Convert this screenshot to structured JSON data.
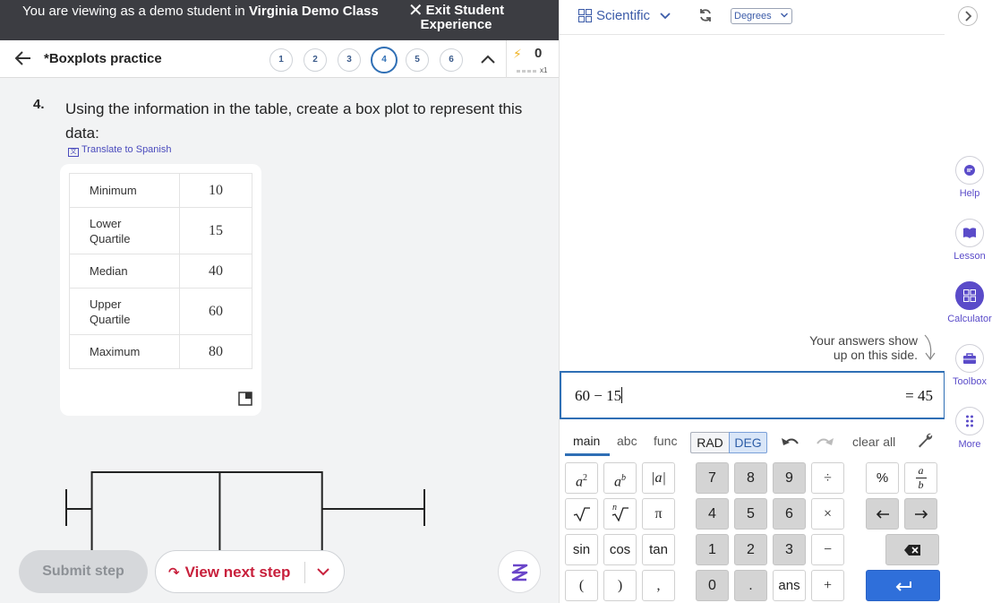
{
  "demo_banner": {
    "message_prefix": "You are viewing as a demo student in ",
    "class_name": "Virginia Demo Class",
    "exit_label_line1": "Exit Student",
    "exit_label_line2": "Experience"
  },
  "header": {
    "title": "*Boxplots practice",
    "steps": [
      "1",
      "2",
      "3",
      "4",
      "5",
      "6"
    ],
    "active_step": "4",
    "streak_count": "0",
    "multiplier": "x1"
  },
  "question": {
    "number": "4.",
    "text": "Using the information in the table, create a box plot to represent this data:",
    "translate_label": "Translate to Spanish"
  },
  "table": {
    "rows": [
      {
        "label": "Minimum",
        "value": "10"
      },
      {
        "label": "Lower Quartile",
        "value": "15"
      },
      {
        "label": "Median",
        "value": "40"
      },
      {
        "label": "Upper Quartile",
        "value": "60"
      },
      {
        "label": "Maximum",
        "value": "80"
      }
    ]
  },
  "boxplot": {
    "minimum": 10,
    "lower_quartile": 15,
    "median": 40,
    "upper_quartile": 60,
    "maximum": 80
  },
  "footer": {
    "submit_label": "Submit step",
    "next_label": "View next step"
  },
  "calculator": {
    "mode": "Scientific",
    "angle_unit": "Degrees",
    "hint_line1": "Your answers show",
    "hint_line2": "up on this side.",
    "expression": "60 − 15",
    "result": "= 45",
    "tabs": [
      "main",
      "abc",
      "func"
    ],
    "rad_label": "RAD",
    "deg_label": "DEG",
    "clear_label": "clear all",
    "keys": {
      "abs": "|a|",
      "pi": "π",
      "sin": "sin",
      "cos": "cos",
      "tan": "tan",
      "lparen": "(",
      "rparen": ")",
      "comma": ",",
      "n7": "7",
      "n8": "8",
      "n9": "9",
      "n4": "4",
      "n5": "5",
      "n6": "6",
      "n1": "1",
      "n2": "2",
      "n3": "3",
      "n0": "0",
      "dot": ".",
      "ans": "ans",
      "divide": "÷",
      "times": "×",
      "minus": "−",
      "plus": "+",
      "percent": "%",
      "frac_top": "a",
      "frac_bottom": "b",
      "sq_base": "a",
      "sq_exp": "2",
      "pow_base": "a",
      "pow_exp": "b",
      "nroot_index": "n"
    }
  },
  "sidebar": {
    "help": "Help",
    "lesson": "Lesson",
    "calculator": "Calculator",
    "toolbox": "Toolbox",
    "more": "More"
  },
  "colors": {
    "accent_blue": "#2f6fb5",
    "sidebar_purple": "#5a4bc9",
    "next_step_red": "#c8203c",
    "enter_key_blue": "#2f6fda"
  }
}
